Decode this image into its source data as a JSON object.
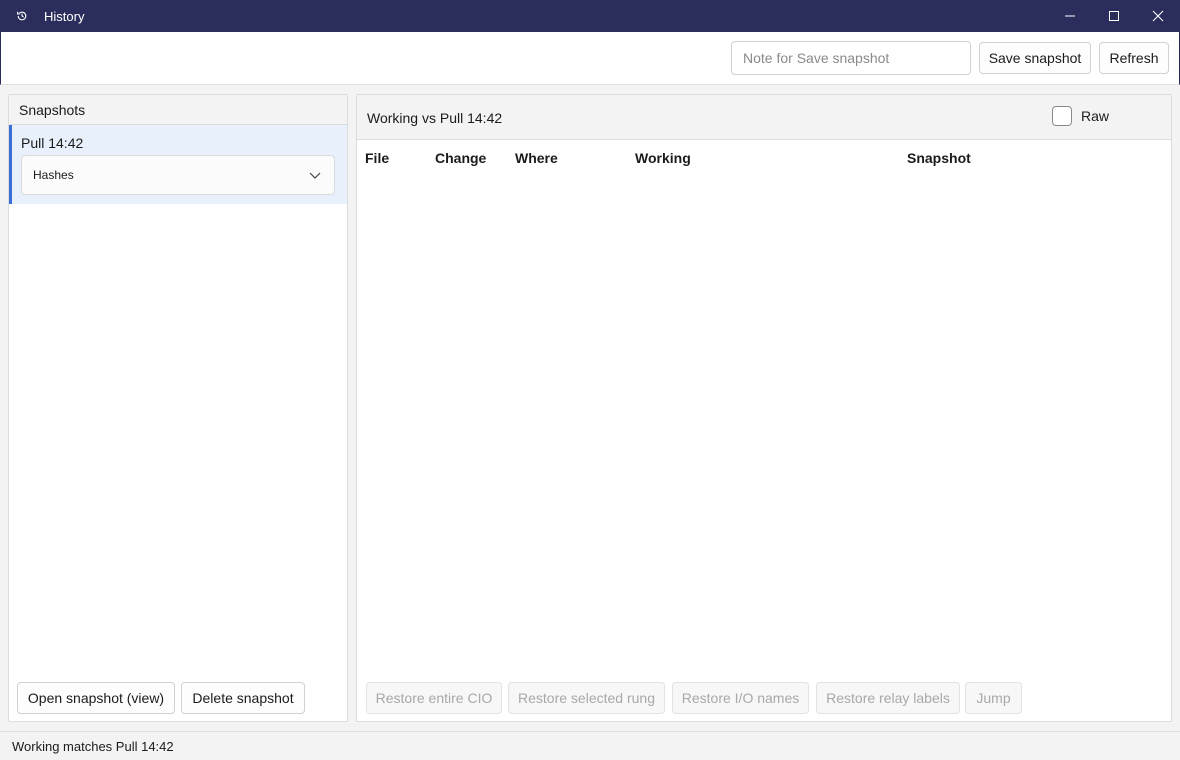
{
  "window": {
    "title": "History",
    "icon": "history-icon"
  },
  "toolbar": {
    "note_placeholder": "Note for Save snapshot",
    "note_value": "",
    "save_label": "Save snapshot",
    "refresh_label": "Refresh"
  },
  "snapshots": {
    "header": "Snapshots",
    "items": [
      {
        "label": "Pull  14:42",
        "detail": "Hashes",
        "selected": true
      }
    ],
    "open_label": "Open snapshot (view)",
    "delete_label": "Delete snapshot"
  },
  "diff": {
    "title": "Working vs Pull  14:42",
    "raw_label": "Raw",
    "raw_checked": false,
    "columns": [
      "File",
      "Change",
      "Where",
      "Working",
      "Snapshot"
    ],
    "rows": [],
    "actions": [
      "Restore entire CIO",
      "Restore selected rung",
      "Restore I/O names",
      "Restore relay labels",
      "Jump"
    ]
  },
  "status": {
    "text": "Working matches Pull  14:42"
  },
  "colors": {
    "titlebar": "#2b2e5c",
    "selection": "#e8f0fb",
    "accent": "#3a6fd8"
  }
}
